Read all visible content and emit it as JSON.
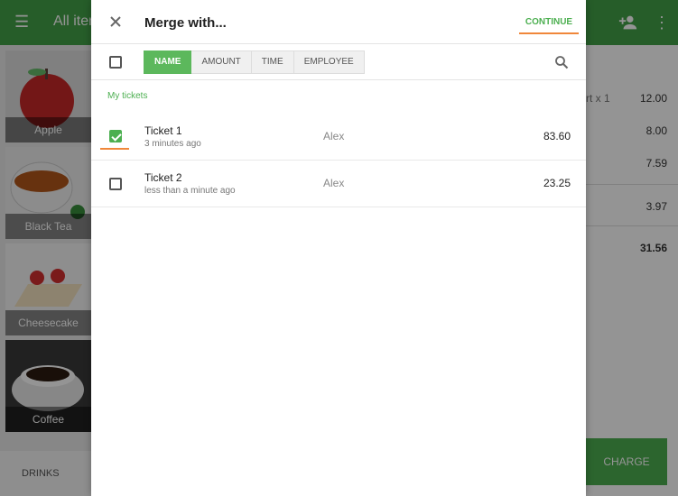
{
  "background": {
    "title": "All items",
    "items": [
      {
        "label": "Apple"
      },
      {
        "label": "Black Tea"
      },
      {
        "label": "Cheesecake"
      },
      {
        "label": "Coffee"
      }
    ],
    "bottom_tab": "DRINKS",
    "ticket_lines": [
      {
        "desc": "rt x 1",
        "amount": "12.00"
      },
      {
        "desc": "",
        "amount": "8.00"
      },
      {
        "desc": "",
        "amount": "7.59"
      },
      {
        "desc": "",
        "amount": "3.97"
      },
      {
        "desc": "",
        "amount": "31.56"
      }
    ],
    "charge_label": "CHARGE"
  },
  "dialog": {
    "title": "Merge with...",
    "continue_label": "CONTINUE",
    "tabs": [
      {
        "label": "NAME",
        "active": true
      },
      {
        "label": "AMOUNT",
        "active": false
      },
      {
        "label": "TIME",
        "active": false
      },
      {
        "label": "EMPLOYEE",
        "active": false
      }
    ],
    "section_label": "My tickets",
    "tickets": [
      {
        "name": "Ticket 1",
        "time": "3 minutes  ago",
        "employee": "Alex",
        "amount": "83.60",
        "checked": true
      },
      {
        "name": "Ticket 2",
        "time": "less than a minute ago",
        "employee": "Alex",
        "amount": "23.25",
        "checked": false
      }
    ]
  },
  "colors": {
    "accent_green": "#4caf50",
    "highlight_orange": "#f0873a",
    "appbar_green": "#43a047"
  },
  "icons": [
    "menu-icon",
    "add-person-icon",
    "more-vert-icon",
    "close-icon",
    "search-icon",
    "checkbox-icon"
  ]
}
